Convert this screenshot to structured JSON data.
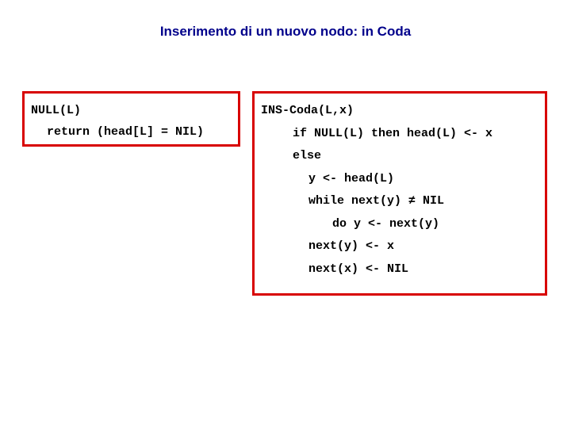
{
  "title": "Inserimento di un nuovo nodo: in Coda",
  "left": {
    "line1": "NULL(L)",
    "line2": "return (head[L] = NIL)"
  },
  "right": {
    "line1": "INS-Coda(L,x)",
    "line2": "if NULL(L) then head(L) <- x",
    "line3": "else",
    "line4": "y <- head(L)",
    "line5": "while next(y) ≠ NIL",
    "line6": "do y <- next(y)",
    "line7": "next(y) <- x",
    "line8": "next(x) <- NIL"
  }
}
